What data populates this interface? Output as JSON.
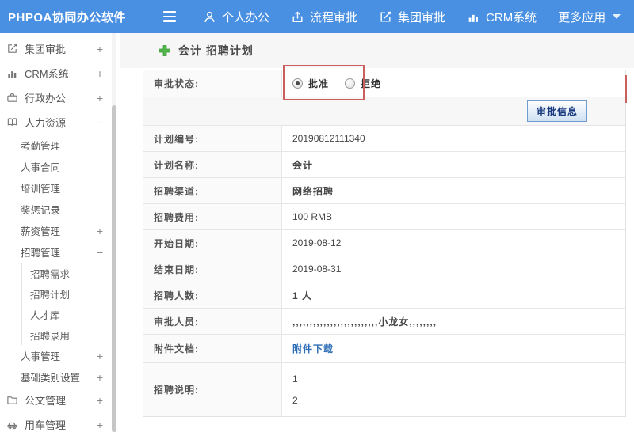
{
  "topbar": {
    "brand": "PHPOA协同办公软件",
    "nav": [
      {
        "label": "个人办公",
        "icon": "user-icon"
      },
      {
        "label": "流程审批",
        "icon": "workflow-export-icon"
      },
      {
        "label": "集团审批",
        "icon": "edit-square-icon"
      },
      {
        "label": "CRM系统",
        "icon": "bar-chart-icon"
      },
      {
        "label": "更多应用",
        "icon": "caret-down-icon"
      }
    ],
    "colors": {
      "background": "#4a90e2",
      "text": "#ffffff"
    }
  },
  "sidebar": {
    "items": [
      {
        "label": "集团审批",
        "icon": "edit-square-icon",
        "toggle": "+"
      },
      {
        "label": "CRM系统",
        "icon": "bar-chart-icon",
        "toggle": "+"
      },
      {
        "label": "行政办公",
        "icon": "briefcase-icon",
        "toggle": "+"
      },
      {
        "label": "人力资源",
        "icon": "book-icon",
        "toggle": "−"
      },
      {
        "label": "考勤管理"
      },
      {
        "label": "人事合同"
      },
      {
        "label": "培训管理"
      },
      {
        "label": "奖惩记录"
      },
      {
        "label": "薪资管理",
        "toggle": "+"
      },
      {
        "label": "招聘管理",
        "toggle": "−"
      },
      {
        "label": "招聘需求"
      },
      {
        "label": "招聘计划"
      },
      {
        "label": "人才库"
      },
      {
        "label": "招聘录用"
      },
      {
        "label": "人事管理",
        "toggle": "+"
      },
      {
        "label": "基础类别设置",
        "toggle": "+"
      },
      {
        "label": "公文管理",
        "icon": "document-icon",
        "toggle": "+"
      },
      {
        "label": "用车管理",
        "icon": "car-icon",
        "toggle": "+"
      }
    ]
  },
  "main": {
    "title": "会计 招聘计划",
    "approval": {
      "label": "审批状态:",
      "options": [
        {
          "label": "批准",
          "selected": true
        },
        {
          "label": "拒绝",
          "selected": false
        }
      ]
    },
    "approval_info_button": "审批信息",
    "fields": [
      {
        "label": "计划编号:",
        "value": "20190812111340"
      },
      {
        "label": "计划名称:",
        "value": "会计"
      },
      {
        "label": "招聘渠道:",
        "value": "网络招聘"
      },
      {
        "label": "招聘费用:",
        "value": "100 RMB"
      },
      {
        "label": "开始日期:",
        "value": "2019-08-12"
      },
      {
        "label": "结束日期:",
        "value": "2019-08-31"
      },
      {
        "label": "招聘人数:",
        "value": "1 人"
      },
      {
        "label": "审批人员:",
        "value": ",,,,,,,,,,,,,,,,,,,,,,,,,小龙女,,,,,,,,"
      },
      {
        "label": "附件文档:",
        "value": "附件下载"
      },
      {
        "label": "招聘说明:",
        "value_lines": [
          "1",
          "2"
        ]
      }
    ],
    "colors": {
      "accent": "#4a90e2",
      "link": "#2d6db5",
      "highlight_border": "#c9605e",
      "button_text": "#17387e"
    }
  }
}
